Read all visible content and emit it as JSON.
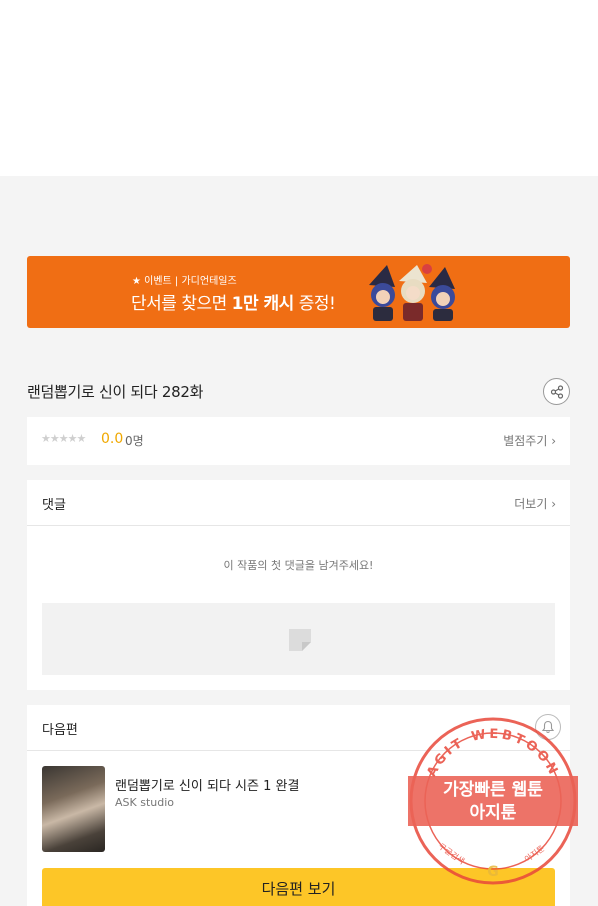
{
  "banner": {
    "sub": "★ 이벤트 | 가디언테일즈",
    "main_prefix": "단서를 찾으면 ",
    "main_bold": "1만 캐시",
    "main_suffix": " 증정!"
  },
  "episode": {
    "title": "랜덤뽑기로 신이 되다 282화"
  },
  "rating": {
    "stars": "★★★★★",
    "score": "0.0",
    "count": "0명",
    "rate_link": "별점주기 ›"
  },
  "comments": {
    "header": "댓글",
    "more": "더보기 ›",
    "empty_message": "이 작품의 첫 댓글을 남겨주세요!"
  },
  "next": {
    "header": "다음편",
    "title": "랜덤뽑기로 신이 되다 시즌 1 완결",
    "author": "ASK studio",
    "button": "다음편 보기"
  },
  "watermark": {
    "ring_text": "AGIT WEBTOON",
    "line1": "가장빠른 웹툰",
    "line2": "아지툰",
    "bottom_left": "구글검색",
    "bottom_right": "아지툰",
    "g": "G"
  },
  "colors": {
    "banner_orange": "#f06e14",
    "score_gold": "#f0a800",
    "button_yellow": "#fdc627",
    "watermark_red": "#e8483a"
  }
}
